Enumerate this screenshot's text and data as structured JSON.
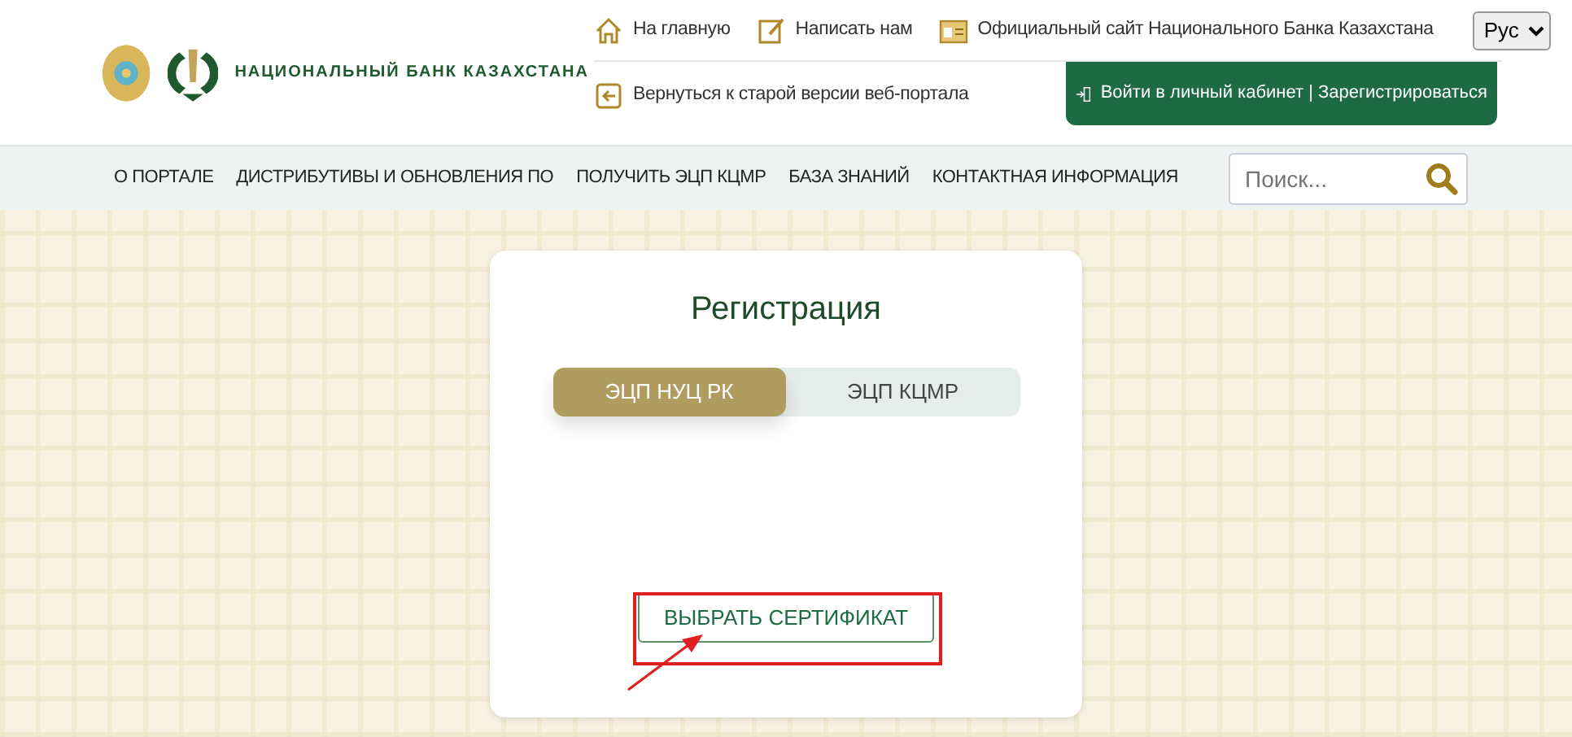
{
  "header": {
    "brand": "НАЦИОНАЛЬНЫЙ БАНК КАЗАХСТАНА",
    "top_links": [
      {
        "kind": "home",
        "label": "На главную"
      },
      {
        "kind": "write",
        "label": "Написать нам"
      },
      {
        "kind": "site",
        "label": "Официальный сайт Национального Банка Казахстана"
      }
    ],
    "language": "Рус",
    "back_link": {
      "label": "Вернуться к старой версии веб-портала"
    },
    "login_button": "Войти в личный кабинет | Зарегистрироваться"
  },
  "nav": {
    "items": [
      "О ПОРТАЛЕ",
      "ДИСТРИБУТИВЫ И ОБНОВЛЕНИЯ ПО",
      "ПОЛУЧИТЬ ЭЦП КЦМР",
      "БАЗА ЗНАНИЙ",
      "КОНТАКТНАЯ ИНФОРМАЦИЯ"
    ],
    "search": {
      "placeholder": "Поиск..."
    }
  },
  "registration": {
    "title": "Регистрация",
    "tabs": [
      {
        "label": "ЭЦП НУЦ РК",
        "selected": true
      },
      {
        "label": "ЭЦП КЦМР",
        "selected": false
      }
    ],
    "button": "ВЫБРАТЬ СЕРТИФИКАТ"
  }
}
